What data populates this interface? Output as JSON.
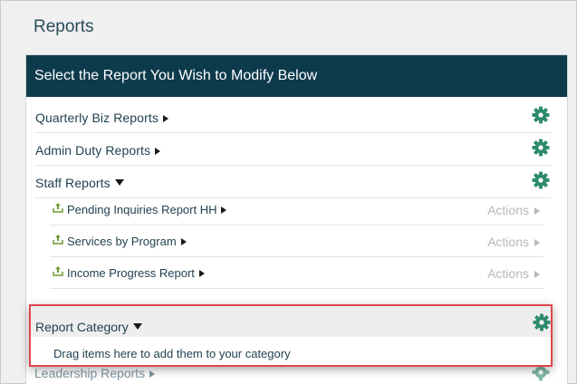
{
  "page": {
    "title": "Reports"
  },
  "panel": {
    "header": "Select the Report You Wish to Modify Below"
  },
  "categories": [
    {
      "label": "Quarterly Biz Reports",
      "expanded": false
    },
    {
      "label": "Admin Duty Reports",
      "expanded": false
    },
    {
      "label": "Staff Reports",
      "expanded": true
    }
  ],
  "staff_reports": [
    {
      "label": "Pending Inquiries Report HH",
      "actions": "Actions"
    },
    {
      "label": "Services by Program",
      "actions": "Actions"
    },
    {
      "label": "Income Progress Report",
      "actions": "Actions"
    }
  ],
  "new_category": {
    "label": "Report Category",
    "drop_hint": "Drag items here to add them to your category"
  },
  "leadership": {
    "label": "Leadership Reports"
  },
  "colors": {
    "header_bg": "#0e3b4c",
    "gear": "#2e8b6e",
    "upload_icon": "#6f9a2e",
    "highlight_border": "#e0474c"
  },
  "icons": {
    "settings": "gear-icon",
    "report": "upload-icon",
    "expand": "triangle-icon"
  }
}
